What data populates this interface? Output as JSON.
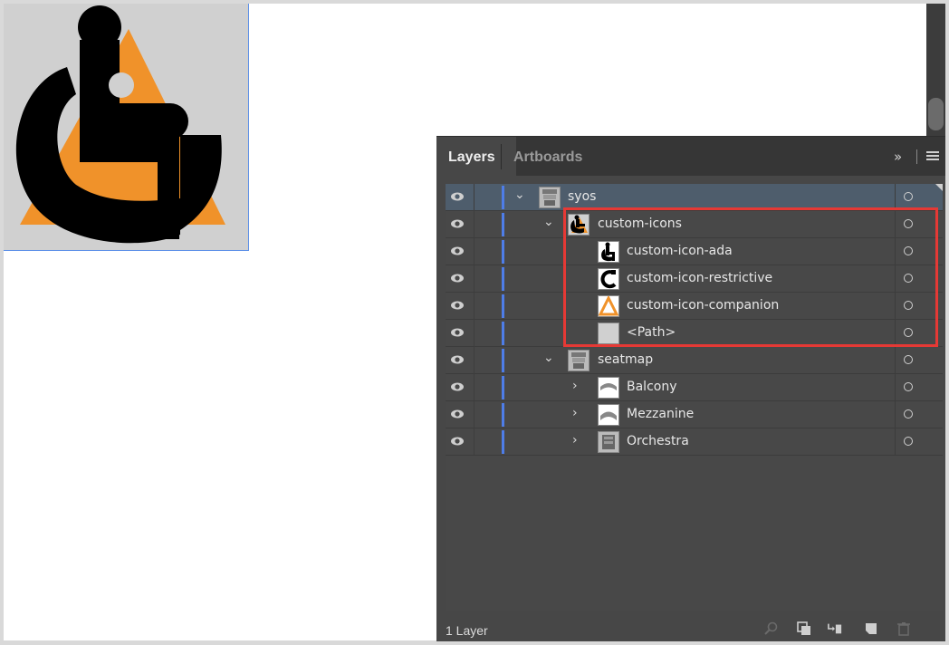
{
  "panel": {
    "tabs": [
      {
        "label": "Layers",
        "active": true
      },
      {
        "label": "Artboards",
        "active": false
      }
    ],
    "overflow_glyph": "»",
    "footer_status": "1 Layer"
  },
  "layers": [
    {
      "name": "syos",
      "level": 0,
      "expanded": true,
      "selected": true,
      "thumb": "seatmap-thumb"
    },
    {
      "name": "custom-icons",
      "level": 1,
      "expanded": true,
      "selected": false,
      "thumb": "custom-icons-thumb"
    },
    {
      "name": "custom-icon-ada",
      "level": 2,
      "expanded": null,
      "selected": false,
      "thumb": "wheelchair-thumb"
    },
    {
      "name": "custom-icon-restrictive",
      "level": 2,
      "expanded": null,
      "selected": false,
      "thumb": "restrictive-thumb"
    },
    {
      "name": "custom-icon-companion",
      "level": 2,
      "expanded": null,
      "selected": false,
      "thumb": "companion-thumb"
    },
    {
      "name": "<Path>",
      "level": 2,
      "expanded": null,
      "selected": false,
      "thumb": "path-thumb"
    },
    {
      "name": "seatmap",
      "level": 1,
      "expanded": true,
      "selected": false,
      "thumb": "seatmap-thumb"
    },
    {
      "name": "Balcony",
      "level": 2,
      "expanded": false,
      "selected": false,
      "thumb": "balcony-thumb"
    },
    {
      "name": "Mezzanine",
      "level": 2,
      "expanded": false,
      "selected": false,
      "thumb": "mezzanine-thumb"
    },
    {
      "name": "Orchestra",
      "level": 2,
      "expanded": false,
      "selected": false,
      "thumb": "orchestra-thumb"
    }
  ],
  "icons": {
    "visibility": "eye-icon",
    "target": "target-circle-icon",
    "footer": [
      "search-icon",
      "clipping-mask-icon",
      "new-sublayer-icon",
      "new-layer-icon",
      "trash-icon"
    ]
  },
  "colors": {
    "layer_color": "#4e7de8",
    "highlight_box": "#e53935",
    "selected_row": "#4e5d6c",
    "orange": "#f0922a"
  }
}
